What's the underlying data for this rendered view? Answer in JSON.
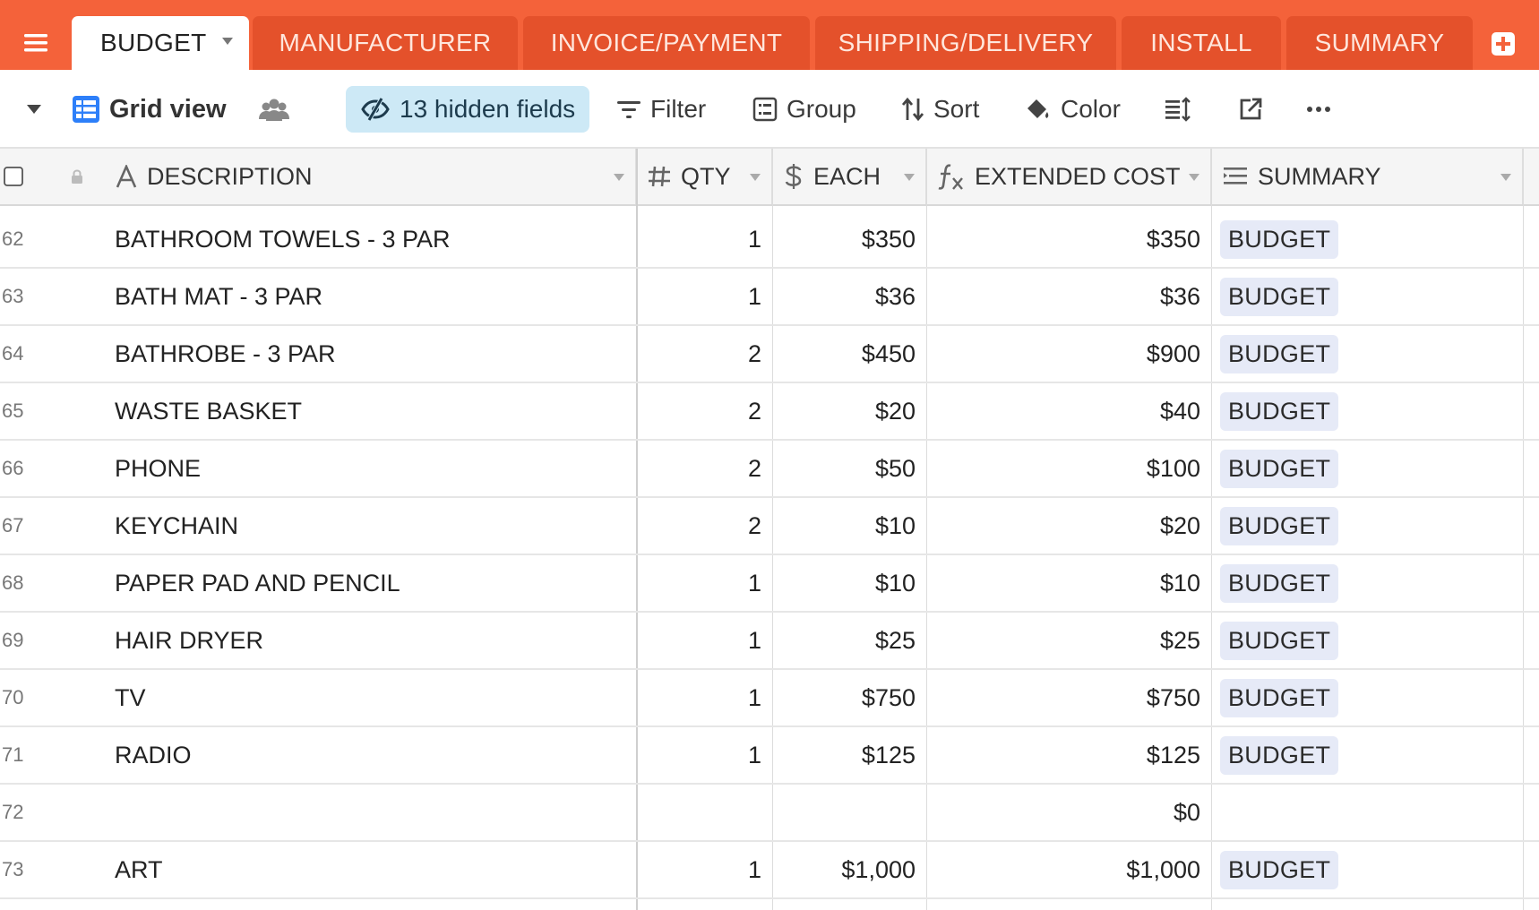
{
  "tabs": [
    {
      "label": "BUDGET",
      "active": true
    },
    {
      "label": "MANUFACTURER",
      "active": false
    },
    {
      "label": "INVOICE/PAYMENT",
      "active": false
    },
    {
      "label": "SHIPPING/DELIVERY",
      "active": false
    },
    {
      "label": "INSTALL",
      "active": false
    },
    {
      "label": "SUMMARY",
      "active": false
    }
  ],
  "toolbar": {
    "view_name": "Grid view",
    "hidden_fields": "13 hidden fields",
    "filter": "Filter",
    "group": "Group",
    "sort": "Sort",
    "color": "Color"
  },
  "columns": {
    "description": "DESCRIPTION",
    "qty": "QTY",
    "each": "EACH",
    "extended_cost": "EXTENDED COST",
    "summary": "SUMMARY"
  },
  "rows": [
    {
      "num": "62",
      "description": "BATHROOM TOWELS - 3 PAR",
      "qty": "1",
      "each": "$350",
      "extended_cost": "$350",
      "summary": "BUDGET"
    },
    {
      "num": "63",
      "description": "BATH MAT - 3 PAR",
      "qty": "1",
      "each": "$36",
      "extended_cost": "$36",
      "summary": "BUDGET"
    },
    {
      "num": "64",
      "description": "BATHROBE - 3 PAR",
      "qty": "2",
      "each": "$450",
      "extended_cost": "$900",
      "summary": "BUDGET"
    },
    {
      "num": "65",
      "description": "WASTE BASKET",
      "qty": "2",
      "each": "$20",
      "extended_cost": "$40",
      "summary": "BUDGET"
    },
    {
      "num": "66",
      "description": "PHONE",
      "qty": "2",
      "each": "$50",
      "extended_cost": "$100",
      "summary": "BUDGET"
    },
    {
      "num": "67",
      "description": "KEYCHAIN",
      "qty": "2",
      "each": "$10",
      "extended_cost": "$20",
      "summary": "BUDGET"
    },
    {
      "num": "68",
      "description": "PAPER PAD AND PENCIL",
      "qty": "1",
      "each": "$10",
      "extended_cost": "$10",
      "summary": "BUDGET"
    },
    {
      "num": "69",
      "description": "HAIR DRYER",
      "qty": "1",
      "each": "$25",
      "extended_cost": "$25",
      "summary": "BUDGET"
    },
    {
      "num": "70",
      "description": "TV",
      "qty": "1",
      "each": "$750",
      "extended_cost": "$750",
      "summary": "BUDGET"
    },
    {
      "num": "71",
      "description": "RADIO",
      "qty": "1",
      "each": "$125",
      "extended_cost": "$125",
      "summary": "BUDGET"
    },
    {
      "num": "72",
      "description": "",
      "qty": "",
      "each": "",
      "extended_cost": "$0",
      "summary": ""
    },
    {
      "num": "73",
      "description": "ART",
      "qty": "1",
      "each": "$1,000",
      "extended_cost": "$1,000",
      "summary": "BUDGET"
    }
  ],
  "colors": {
    "tabbar": "#f4623a",
    "tab_inactive": "#e4512b",
    "hidden_fields_bg": "#cde9f6",
    "badge_bg": "#e6eaf7",
    "grid_icon": "#2d7ff9"
  }
}
